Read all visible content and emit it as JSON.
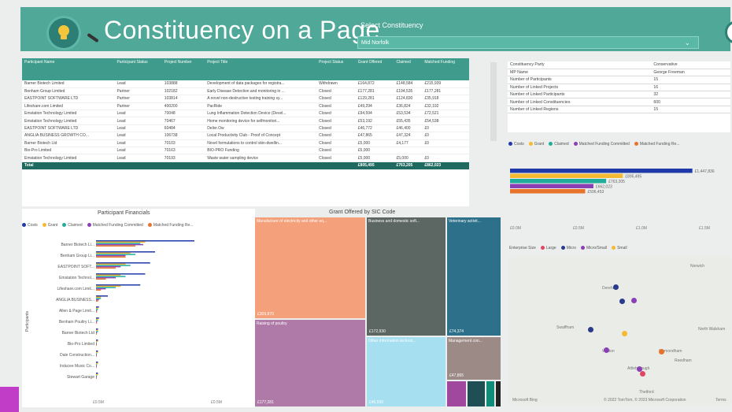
{
  "header": {
    "title": "Constituency on a Page",
    "select_label": "Select Constituency",
    "select_value": "Mid Norfolk"
  },
  "colors": {
    "costs": "#1f3aa8",
    "grant": "#f5b932",
    "claimed": "#1fae9c",
    "mf_committed": "#8a3fb5",
    "mf_received": "#e8732a"
  },
  "projects": {
    "columns": [
      "Participant Name",
      "Participant Status",
      "Project Number",
      "Project Title",
      "Project Status",
      "Grant Offered",
      "Claimed",
      "Matched Funding"
    ],
    "rows": [
      [
        "Barner Biotech Limited",
        "Lead",
        "103888",
        "Development of data packages for registra...",
        "Withdrawn",
        "£164,872",
        "£148,584",
        "£215,939"
      ],
      [
        "Benham Group Limited",
        "Partner",
        "102182",
        "Early Disease Detection and monitoring in ...",
        "Closed",
        "£177,281",
        "£194,535",
        "£177,281"
      ],
      [
        "EASTPOINT SOFTWARE LTD",
        "Partner",
        "103814",
        "A novel non-destructive testing training sy...",
        "Closed",
        "£129,281",
        "£124,830",
        "£35,918"
      ],
      [
        "Lifeshare.com Limited",
        "Partner",
        "400200",
        "PacRide",
        "Closed",
        "£49,294",
        "£36,824",
        "£32,192"
      ],
      [
        "Emstation Technology Limited",
        "Lead",
        "70048",
        "Lung Inflammation Detection Device (Devel...",
        "Closed",
        "£94,594",
        "£53,534",
        "£72,521"
      ],
      [
        "Emstation Technology Limited",
        "Lead",
        "70467",
        "Home monitoring device for selfmonitori...",
        "Closed",
        "£53,192",
        "£55,435",
        "£54,538"
      ],
      [
        "EASTPOINT SOFTWARE LTD",
        "Lead",
        "60484",
        "Delivr.Ow",
        "Closed",
        "£46,772",
        "£46,400",
        "£0"
      ],
      [
        "ANGLIA BUSINESS GROWTH CO...",
        "Lead",
        "106738",
        "Local Productivity Club - Proof of Concept",
        "Closed",
        "£47,865",
        "£47,324",
        "£0"
      ],
      [
        "Barner Biotech Ltd",
        "Lead",
        "70103",
        "Novel formulations to control skin-dwellin...",
        "Closed",
        "£5,000",
        "£4,177",
        "£0"
      ],
      [
        "Bio-Pro Limited",
        "Lead",
        "70163",
        "BIO-PRO Funding",
        "Closed",
        "£5,000",
        "",
        ""
      ],
      [
        "Emstation Technology Limited",
        "Lead",
        "70193",
        "Waste water sampling device",
        "Closed",
        "£5,000",
        "£5,000",
        "£0"
      ]
    ],
    "total": [
      "Total",
      "",
      "",
      "",
      "",
      "£805,495",
      "£763,205",
      "£862,023"
    ]
  },
  "summary": [
    [
      "Constituency Party",
      "Conservative"
    ],
    [
      "MP Name",
      "George Freeman"
    ],
    [
      "Number of Participants",
      "15"
    ],
    [
      "Number of Linked Projects",
      "16"
    ],
    [
      "Number of Linked Participants",
      "32"
    ],
    [
      "Number of Linked Constituencies",
      "600"
    ],
    [
      "Number of Linked Regions",
      "15"
    ]
  ],
  "legend_top": [
    "Costs",
    "Grant",
    "Claimed",
    "Matched Funding Committed",
    "Matched Funding Re..."
  ],
  "summary_bars": {
    "values": [
      "£1,447,836",
      "£895,495",
      "£763,205",
      "£662,023",
      "£596,453"
    ],
    "axis": [
      "£0.0M",
      "£0.5M",
      "£1.0M",
      "£1.5M"
    ]
  },
  "participant_fin": {
    "title": "Participant Financials",
    "legend": [
      "Costs",
      "Grant",
      "Claimed",
      "Matched Funding Committed",
      "Matched Funding Re..."
    ],
    "ylabel": "Participants",
    "axis": [
      "£0.5M",
      "£0.5M"
    ],
    "names": [
      "Barner Biotech Li...",
      "Benham Group Li...",
      "EASTPOINT SOFT...",
      "Emstation Technol...",
      "Lifeshare.com Limit...",
      "ANGLIA BUSINESS...",
      "Allen & Page Limit...",
      "Benham Poultry Li...",
      "Barner Biotech Ltd",
      "Bio-Pro Limited",
      "Dale Construction...",
      "Inducee Music Co...",
      "Stewart Garage"
    ],
    "bars": [
      [
        1.0,
        0.5,
        0.45,
        0.48,
        0.4
      ],
      [
        0.6,
        0.35,
        0.4,
        0.3,
        0.3
      ],
      [
        0.55,
        0.3,
        0.35,
        0.25,
        0.2
      ],
      [
        0.5,
        0.25,
        0.3,
        0.2,
        0.1
      ],
      [
        0.45,
        0.25,
        0.2,
        0.1,
        0.05
      ],
      [
        0.12,
        0.05,
        0.05,
        0.03,
        0.02
      ],
      [
        0.03,
        0.02,
        0.02,
        0.01,
        0.01
      ],
      [
        0.03,
        0.02,
        0.02,
        0.01,
        0.01
      ],
      [
        0.02,
        0.02,
        0.02,
        0.01,
        0.0
      ],
      [
        0.02,
        0.02,
        0.0,
        0.0,
        0.0
      ],
      [
        0.02,
        0.02,
        0.01,
        0.0,
        0.0
      ],
      [
        0.02,
        0.02,
        0.01,
        0.0,
        0.0
      ],
      [
        0.02,
        0.02,
        0.01,
        0.0,
        0.0
      ]
    ]
  },
  "treemap": {
    "title": "Grant Offered by SIC Code",
    "cells": [
      {
        "label": "Manufacture of electricity and other eq...",
        "value": "£309,870",
        "color": "#f4a07a"
      },
      {
        "label": "Raising of poultry",
        "value": "£177,281",
        "color": "#b07aa8"
      },
      {
        "label": "Business and domestic soft...",
        "value": "£172,930",
        "color": "#5c6663"
      },
      {
        "label": "Veterinary activit...",
        "value": "£74,374",
        "color": "#2d7089"
      },
      {
        "label": "Other information technol...",
        "value": "£46,500",
        "color": "#a6dff0"
      },
      {
        "label": "Management con...",
        "value": "£47,865",
        "color": "#9c8a87"
      },
      {
        "label": "",
        "value": "",
        "color": "#a0489e"
      },
      {
        "label": "",
        "value": "",
        "color": "#1f4f55"
      },
      {
        "label": "",
        "value": "",
        "color": "#0f8c7a"
      },
      {
        "label": "",
        "value": "",
        "color": "#222"
      }
    ]
  },
  "map": {
    "legend_label": "Enterprise Size",
    "legend": [
      "Large",
      "Micro",
      "Micro/Small",
      "Small"
    ],
    "places": [
      "Dereham",
      "Swaffham",
      "Watton",
      "Wymondham",
      "Attleborough",
      "Thetford",
      "Norwich",
      "North Walsham",
      "Reedham"
    ],
    "copyright": "© 2022 TomTom, © 2023 Microsoft Corporation",
    "terms": "Terms",
    "brand": "Microsoft Bing"
  }
}
